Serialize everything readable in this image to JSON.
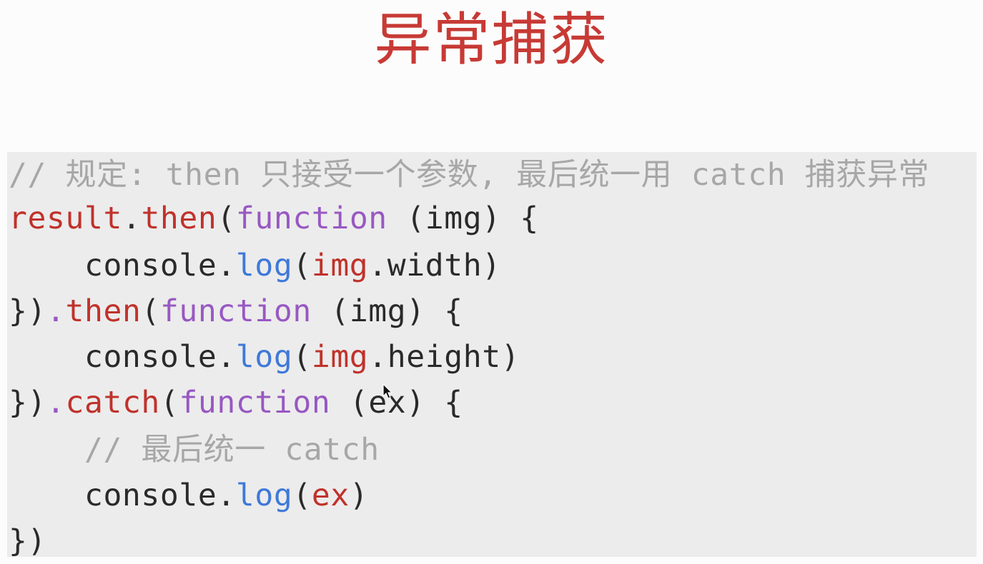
{
  "slide": {
    "title": "异常捕获",
    "title_color": "#c73a35"
  },
  "code": {
    "colors": {
      "comment": "#a7a7a7",
      "variable": "#c0322b",
      "method": "#c0322b",
      "keyword": "#9858c2",
      "log": "#3f79d9",
      "plain": "#2a2a2a"
    },
    "lines": [
      [
        {
          "t": "comment",
          "v": "// 规定: then 只接受一个参数, 最后统一用 catch 捕获异常"
        }
      ],
      [
        {
          "t": "variable",
          "v": "result"
        },
        {
          "t": "plain",
          "v": "."
        },
        {
          "t": "method",
          "v": "then"
        },
        {
          "t": "plain",
          "v": "("
        },
        {
          "t": "keyword",
          "v": "function"
        },
        {
          "t": "plain",
          "v": " (img) {"
        }
      ],
      [
        {
          "t": "plain",
          "v": "    console."
        },
        {
          "t": "log",
          "v": "log"
        },
        {
          "t": "plain",
          "v": "("
        },
        {
          "t": "variable",
          "v": "img"
        },
        {
          "t": "plain",
          "v": ".width)"
        }
      ],
      [
        {
          "t": "plain",
          "v": "})"
        },
        {
          "t": "keyword",
          "v": "."
        },
        {
          "t": "method",
          "v": "then"
        },
        {
          "t": "plain",
          "v": "("
        },
        {
          "t": "keyword",
          "v": "function"
        },
        {
          "t": "plain",
          "v": " (img) {"
        }
      ],
      [
        {
          "t": "plain",
          "v": "    console."
        },
        {
          "t": "log",
          "v": "log"
        },
        {
          "t": "plain",
          "v": "("
        },
        {
          "t": "variable",
          "v": "img"
        },
        {
          "t": "plain",
          "v": ".height)"
        }
      ],
      [
        {
          "t": "plain",
          "v": "})"
        },
        {
          "t": "keyword",
          "v": "."
        },
        {
          "t": "method",
          "v": "catch"
        },
        {
          "t": "plain",
          "v": "("
        },
        {
          "t": "keyword",
          "v": "function"
        },
        {
          "t": "plain",
          "v": " (ex) {"
        }
      ],
      [
        {
          "t": "comment",
          "v": "    // 最后统一 catch"
        }
      ],
      [
        {
          "t": "plain",
          "v": "    console."
        },
        {
          "t": "log",
          "v": "log"
        },
        {
          "t": "plain",
          "v": "("
        },
        {
          "t": "variable",
          "v": "ex"
        },
        {
          "t": "plain",
          "v": ")"
        }
      ],
      [
        {
          "t": "plain",
          "v": "})"
        }
      ]
    ]
  }
}
